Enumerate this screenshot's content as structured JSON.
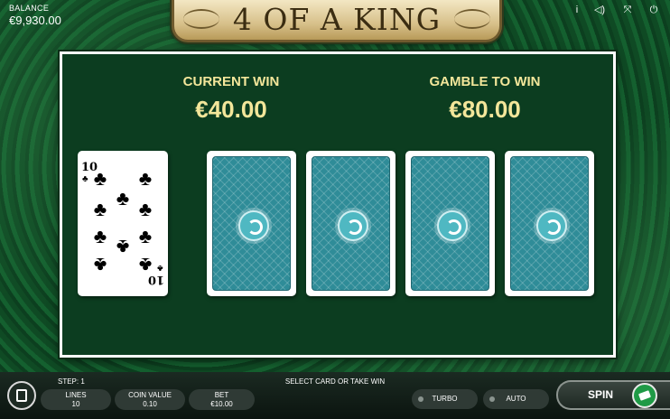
{
  "balance": {
    "label": "BALANCE",
    "value": "€9,930.00"
  },
  "title": "4 OF A KING",
  "top_icons": [
    "info-icon",
    "sound-icon",
    "fullscreen-icon",
    "power-icon"
  ],
  "top_icon_glyphs": {
    "info": "i",
    "sound": "◁)",
    "fullscreen": "⤧",
    "power": "⏻"
  },
  "current_win": {
    "label": "CURRENT WIN",
    "value": "€40.00"
  },
  "gamble_to_win": {
    "label": "GAMBLE TO WIN",
    "value": "€80.00"
  },
  "dealer_card": {
    "rank": "10",
    "suit": "♣"
  },
  "card_backs_count": 4,
  "bottom": {
    "step": "STEP: 1",
    "prompt": "SELECT CARD OR TAKE WIN",
    "lines": {
      "label": "LINES",
      "value": "10"
    },
    "coin_value": {
      "label": "COIN VALUE",
      "value": "0.10"
    },
    "bet": {
      "label": "BET",
      "value": "€10.00"
    },
    "turbo": "TURBO",
    "auto": "AUTO",
    "spin": "SPIN"
  },
  "colors": {
    "accent_gold": "#f3e69a",
    "table_green": "#0c3d20",
    "card_back_teal": "#2f8c98"
  }
}
